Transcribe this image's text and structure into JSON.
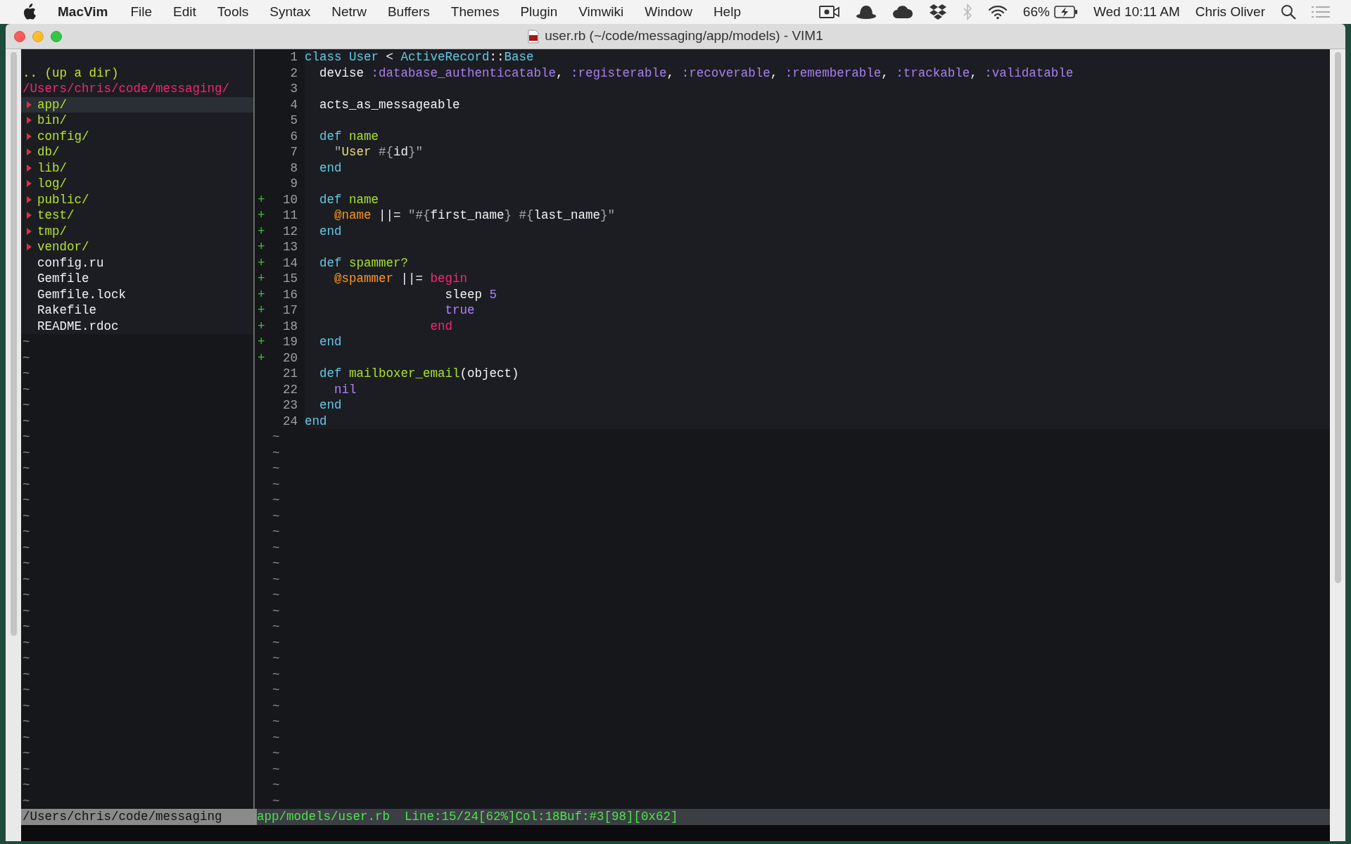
{
  "menu_bar": {
    "app_name": "MacVim",
    "menus": [
      "File",
      "Edit",
      "Tools",
      "Syntax",
      "Netrw",
      "Buffers",
      "Themes",
      "Plugin",
      "Vimwiki",
      "Window",
      "Help"
    ],
    "battery": "66%",
    "clock": "Wed 10:11 AM",
    "user": "Chris Oliver"
  },
  "window": {
    "title": "user.rb (~/code/messaging/app/models) - VIM1"
  },
  "file_tree": {
    "parent_link": ".. (up a dir)",
    "root": "/Users/chris/code/messaging/",
    "entries": [
      {
        "name": "app/",
        "kind": "dir",
        "selected": true
      },
      {
        "name": "bin/",
        "kind": "dir",
        "selected": false
      },
      {
        "name": "config/",
        "kind": "dir",
        "selected": false
      },
      {
        "name": "db/",
        "kind": "dir",
        "selected": false
      },
      {
        "name": "lib/",
        "kind": "dir",
        "selected": false
      },
      {
        "name": "log/",
        "kind": "dir",
        "selected": false
      },
      {
        "name": "public/",
        "kind": "dir",
        "selected": false
      },
      {
        "name": "test/",
        "kind": "dir",
        "selected": false
      },
      {
        "name": "tmp/",
        "kind": "dir",
        "selected": false
      },
      {
        "name": "vendor/",
        "kind": "dir",
        "selected": false
      },
      {
        "name": "config.ru",
        "kind": "file",
        "selected": false
      },
      {
        "name": "Gemfile",
        "kind": "file",
        "selected": false
      },
      {
        "name": "Gemfile.lock",
        "kind": "file",
        "selected": false
      },
      {
        "name": "Rakefile",
        "kind": "file",
        "selected": false
      },
      {
        "name": "README.rdoc",
        "kind": "file",
        "selected": false
      }
    ],
    "filler": [
      "~",
      "~",
      "~",
      "~",
      "~",
      "~",
      "~",
      "~",
      "~",
      "~",
      "~",
      "~",
      "~",
      "~",
      "~",
      "~",
      "~",
      "~",
      "~",
      "~",
      "~",
      "~",
      "~",
      "~",
      "~",
      "~",
      "~",
      "~",
      "~",
      "~"
    ]
  },
  "editor": {
    "lines": [
      {
        "number": "1",
        "tokens": [
          {
            "text": "class ",
            "kind": "keyword"
          },
          {
            "text": "User",
            "kind": "constant"
          },
          {
            "text": " < ",
            "kind": "plain"
          },
          {
            "text": "ActiveRecord",
            "kind": "constant"
          },
          {
            "text": "::",
            "kind": "plain"
          },
          {
            "text": "Base",
            "kind": "constant"
          }
        ]
      },
      {
        "number": "2",
        "tokens": [
          {
            "text": "  devise ",
            "kind": "plain"
          },
          {
            "text": ":database_authenticatable",
            "kind": "symbol"
          },
          {
            "text": ", ",
            "kind": "plain"
          },
          {
            "text": ":registerable",
            "kind": "symbol"
          },
          {
            "text": ", ",
            "kind": "plain"
          },
          {
            "text": ":recoverable",
            "kind": "symbol"
          },
          {
            "text": ", ",
            "kind": "plain"
          },
          {
            "text": ":rememberable",
            "kind": "symbol"
          },
          {
            "text": ", ",
            "kind": "plain"
          },
          {
            "text": ":trackable",
            "kind": "symbol"
          },
          {
            "text": ", ",
            "kind": "plain"
          },
          {
            "text": ":validatable",
            "kind": "symbol"
          }
        ]
      },
      {
        "number": "3"
      },
      {
        "number": "4",
        "tokens": [
          {
            "text": "  acts_as_messageable",
            "kind": "plain"
          }
        ]
      },
      {
        "number": "5"
      },
      {
        "number": "6",
        "tokens": [
          {
            "text": "  def ",
            "kind": "keyword"
          },
          {
            "text": "name",
            "kind": "method"
          }
        ]
      },
      {
        "number": "7",
        "tokens": [
          {
            "text": "    \"",
            "kind": "punct"
          },
          {
            "text": "User ",
            "kind": "string"
          },
          {
            "text": "#{",
            "kind": "punct"
          },
          {
            "text": "id",
            "kind": "plain"
          },
          {
            "text": "}\"",
            "kind": "punct"
          }
        ]
      },
      {
        "number": "8",
        "tokens": [
          {
            "text": "  end",
            "kind": "keyword"
          }
        ]
      },
      {
        "number": "9"
      },
      {
        "number": "10",
        "sign": "+",
        "tokens": [
          {
            "text": "  def ",
            "kind": "keyword"
          },
          {
            "text": "name",
            "kind": "method"
          }
        ]
      },
      {
        "number": "11",
        "sign": "+",
        "tokens": [
          {
            "text": "    @name",
            "kind": "ivar"
          },
          {
            "text": " ||= ",
            "kind": "plain"
          },
          {
            "text": "\"#{",
            "kind": "punct"
          },
          {
            "text": "first_name",
            "kind": "plain"
          },
          {
            "text": "} #{",
            "kind": "punct"
          },
          {
            "text": "last_name",
            "kind": "plain"
          },
          {
            "text": "}\"",
            "kind": "punct"
          }
        ]
      },
      {
        "number": "12",
        "sign": "+",
        "tokens": [
          {
            "text": "  end",
            "kind": "keyword"
          }
        ]
      },
      {
        "number": "13",
        "sign": "+"
      },
      {
        "number": "14",
        "sign": "+",
        "tokens": [
          {
            "text": "  def ",
            "kind": "keyword"
          },
          {
            "text": "spammer?",
            "kind": "method"
          }
        ]
      },
      {
        "number": "15",
        "sign": "+",
        "tokens": [
          {
            "text": "    @spammer",
            "kind": "ivar"
          },
          {
            "text": " ||= ",
            "kind": "plain"
          },
          {
            "text": "begin",
            "kind": "control"
          }
        ]
      },
      {
        "number": "16",
        "sign": "+",
        "tokens": [
          {
            "text": "                   sleep ",
            "kind": "plain"
          },
          {
            "text": "5",
            "kind": "literal"
          }
        ]
      },
      {
        "number": "17",
        "sign": "+",
        "tokens": [
          {
            "text": "                   true",
            "kind": "literal"
          }
        ]
      },
      {
        "number": "18",
        "sign": "+",
        "tokens": [
          {
            "text": "                 end",
            "kind": "control"
          }
        ]
      },
      {
        "number": "19",
        "sign": "+",
        "tokens": [
          {
            "text": "  end",
            "kind": "keyword"
          }
        ]
      },
      {
        "number": "20",
        "sign": "+"
      },
      {
        "number": "21",
        "tokens": [
          {
            "text": "  def ",
            "kind": "keyword"
          },
          {
            "text": "mailboxer_email",
            "kind": "method"
          },
          {
            "text": "(object)",
            "kind": "plain"
          }
        ]
      },
      {
        "number": "22",
        "tokens": [
          {
            "text": "    nil",
            "kind": "literal"
          }
        ]
      },
      {
        "number": "23",
        "tokens": [
          {
            "text": "  end",
            "kind": "keyword"
          }
        ]
      },
      {
        "number": "24",
        "tokens": [
          {
            "text": "end",
            "kind": "keyword"
          }
        ]
      }
    ],
    "filler": [
      "~",
      "~",
      "~",
      "~",
      "~",
      "~",
      "~",
      "~",
      "~",
      "~",
      "~",
      "~",
      "~",
      "~",
      "~",
      "~",
      "~",
      "~",
      "~",
      "~",
      "~",
      "~",
      "~",
      "~"
    ]
  },
  "status_bar": {
    "left": "/Users/chris/code/messaging",
    "right": "app/models/user.rb  Line:15/24[62%]Col:18Buf:#3[98][0x62]"
  }
}
